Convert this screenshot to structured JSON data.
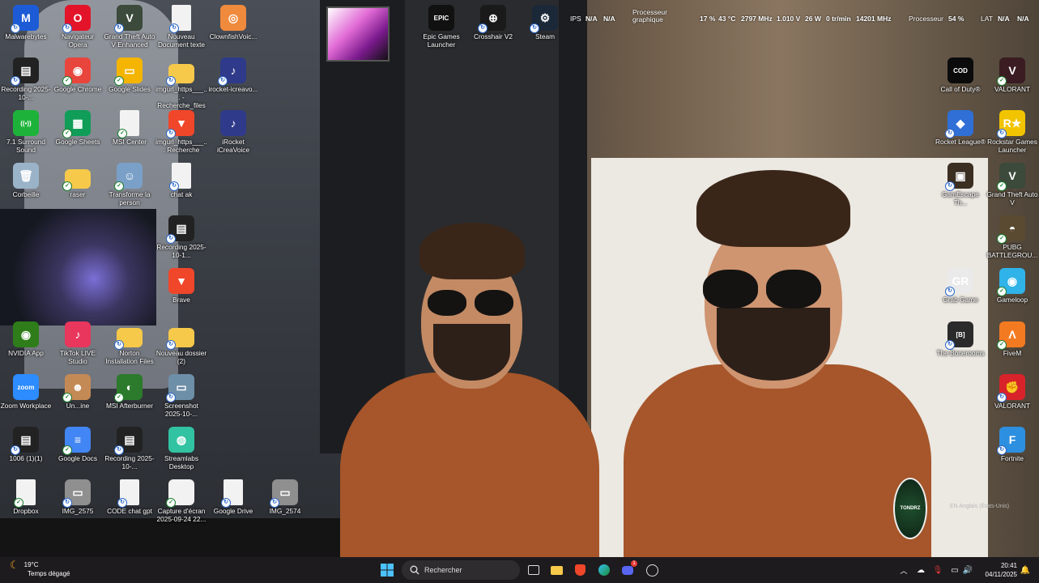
{
  "hud": {
    "ips_label": "IPS",
    "ips_val1": "N/A",
    "ips_val2": "N/A",
    "gpu_label_line1": "Processeur",
    "gpu_label_line2": "graphique",
    "gpu_usage": "17 %",
    "gpu_temp": "43 °C",
    "gpu_clock": "2797 MHz",
    "gpu_voltage": "1.010 V",
    "gpu_power": "26 W",
    "gpu_fan": "0 tr/min",
    "gpu_mem_clock": "14201 MHz",
    "cpu_label": "Processeur",
    "cpu_usage": "54 %",
    "lat_label": "LAT",
    "lat_val1": "N/A",
    "lat_val2": "N/A"
  },
  "desktop_icons": [
    {
      "label": "Malwarebytes",
      "icon": "malwarebytes-icon",
      "color": "#1d5bd6",
      "glyph": "M",
      "badge": "sync"
    },
    {
      "label": "Navigateur Opera",
      "icon": "opera-icon",
      "color": "#e3142a",
      "glyph": "O",
      "badge": "sync"
    },
    {
      "label": "Grand Theft Auto V Enhanced",
      "icon": "gta-icon",
      "color": "#3b4a3a",
      "glyph": "V",
      "badge": "sync"
    },
    {
      "label": "Nouveau Document texte",
      "icon": "text-file-icon",
      "color": "#f2f2f2",
      "glyph": "",
      "badge": "sync"
    },
    {
      "label": "ClownfishVoic...",
      "icon": "clownfish-icon",
      "color": "#f08a3c",
      "glyph": "◎",
      "badge": ""
    },
    {
      "label": "Recording 2025-10-...",
      "icon": "video-file-icon",
      "color": "#222",
      "glyph": "▤",
      "badge": "sync"
    },
    {
      "label": "Google Chrome",
      "icon": "chrome-icon",
      "color": "#e8453c",
      "glyph": "◉",
      "badge": "ok"
    },
    {
      "label": "Google Slides",
      "icon": "slides-icon",
      "color": "#f4b400",
      "glyph": "▭",
      "badge": "ok"
    },
    {
      "label": "imgurl_https___... - Recherche_files",
      "icon": "folder-icon",
      "color": "#f6c94a",
      "glyph": "",
      "badge": "sync"
    },
    {
      "label": "irocket-icreavo...",
      "icon": "irocket-icon",
      "color": "#2f3a8a",
      "glyph": "♪",
      "badge": "sync"
    },
    {
      "label": "7.1 Surround Sound",
      "icon": "surround-icon",
      "color": "#1db33a",
      "glyph": "((•))",
      "badge": ""
    },
    {
      "label": "Google Sheets",
      "icon": "sheets-icon",
      "color": "#0f9d58",
      "glyph": "▦",
      "badge": "ok"
    },
    {
      "label": "MSI Center",
      "icon": "text-file-icon",
      "color": "#f2f2f2",
      "glyph": "",
      "badge": "ok"
    },
    {
      "label": "imgurl_https___... Recherche",
      "icon": "brave-icon",
      "color": "#f0462a",
      "glyph": "▼",
      "badge": "sync"
    },
    {
      "label": "iRocket iCreaVoice",
      "icon": "irocket-icon",
      "color": "#2f3a8a",
      "glyph": "♪",
      "badge": ""
    },
    {
      "label": "Corbeille",
      "icon": "recycle-bin-icon",
      "color": "#9bb3c9",
      "glyph": "🗑",
      "badge": ""
    },
    {
      "label": "raser",
      "icon": "folder-icon",
      "color": "#f6c94a",
      "glyph": "",
      "badge": "ok"
    },
    {
      "label": "Transforme la person",
      "icon": "image-file-icon",
      "color": "#7aa0c8",
      "glyph": "☺",
      "badge": "ok"
    },
    {
      "label": "chat ak",
      "icon": "text-file-icon",
      "color": "#f2f2f2",
      "glyph": "",
      "badge": "sync"
    },
    {
      "label": "Recording 2025-10-1...",
      "icon": "video-file-icon",
      "color": "#222",
      "glyph": "▤",
      "badge": "sync"
    },
    {
      "label": "Brave",
      "icon": "brave-icon",
      "color": "#f0462a",
      "glyph": "▼",
      "badge": ""
    },
    {
      "label": "NVIDIA App",
      "icon": "nvidia-icon",
      "color": "#2e7d1a",
      "glyph": "◉",
      "badge": ""
    },
    {
      "label": "TikTok LIVE Studio",
      "icon": "tiktok-icon",
      "color": "#e8365d",
      "glyph": "♪",
      "badge": ""
    },
    {
      "label": "Norton Installation Files",
      "icon": "folder-icon",
      "color": "#f6c94a",
      "glyph": "",
      "badge": "sync"
    },
    {
      "label": "Nouveau dossier (2)",
      "icon": "folder-icon",
      "color": "#f6c94a",
      "glyph": "",
      "badge": "sync"
    },
    {
      "label": "Zoom Workplace",
      "icon": "zoom-icon",
      "color": "#2d8cff",
      "glyph": "zoom",
      "badge": ""
    },
    {
      "label": "Un...ine",
      "icon": "figure-icon",
      "color": "#c48a55",
      "glyph": "☻",
      "badge": "ok"
    },
    {
      "label": "MSI Afterburner",
      "icon": "afterburner-icon",
      "color": "#2c7a2c",
      "glyph": "◐",
      "badge": "ok"
    },
    {
      "label": "Screenshot 2025-10-...",
      "icon": "image-file-icon",
      "color": "#6e8fa8",
      "glyph": "▭",
      "badge": "sync"
    },
    {
      "label": "1006 (1)(1)",
      "icon": "video-file-icon",
      "color": "#222",
      "glyph": "▤",
      "badge": "sync"
    },
    {
      "label": "Google Docs",
      "icon": "docs-icon",
      "color": "#4285f4",
      "glyph": "≡",
      "badge": "ok"
    },
    {
      "label": "Recording 2025-10-...",
      "icon": "video-file-icon",
      "color": "#222",
      "glyph": "▤",
      "badge": "sync"
    },
    {
      "label": "Streamlabs Desktop",
      "icon": "streamlabs-icon",
      "color": "#31c3a2",
      "glyph": "◍",
      "badge": ""
    },
    {
      "label": "Dropbox",
      "icon": "text-file-icon",
      "color": "#f2f2f2",
      "glyph": "",
      "badge": "ok"
    },
    {
      "label": "IMG_2575",
      "icon": "image-file-icon",
      "color": "#8f8f8f",
      "glyph": "▭",
      "badge": "sync"
    },
    {
      "label": "CODE chat gpt",
      "icon": "text-file-icon",
      "color": "#f2f2f2",
      "glyph": "",
      "badge": "sync"
    },
    {
      "label": "Capture d'écran 2025-09-24 22...",
      "icon": "image-file-icon",
      "color": "#f2f2f2",
      "glyph": "",
      "badge": "ok"
    },
    {
      "label": "Google Drive",
      "icon": "text-file-icon",
      "color": "#f2f2f2",
      "glyph": "",
      "badge": "sync"
    },
    {
      "label": "IMG_2574",
      "icon": "image-file-icon",
      "color": "#8f8f8f",
      "glyph": "▭",
      "badge": "sync"
    },
    {
      "label": "Epic Games Launcher",
      "icon": "epic-icon",
      "color": "#111",
      "glyph": "EPIC",
      "badge": ""
    },
    {
      "label": "Crosshair V2",
      "icon": "crosshair-icon",
      "color": "#1a1a1a",
      "glyph": "⊕",
      "badge": "sync"
    },
    {
      "label": "Steam",
      "icon": "steam-icon",
      "color": "#1b2838",
      "glyph": "⚙",
      "badge": "sync"
    },
    {
      "label": "Call of Duty®",
      "icon": "cod-icon",
      "color": "#0b0b0b",
      "glyph": "COD",
      "badge": ""
    },
    {
      "label": "VALORANT",
      "icon": "valorant-icon",
      "color": "#3a1c22",
      "glyph": "V",
      "badge": "ok"
    },
    {
      "label": "Rocket League®",
      "icon": "rocket-league-icon",
      "color": "#2f6fd6",
      "glyph": "◆",
      "badge": "sync"
    },
    {
      "label": "Rockstar Games Launcher",
      "icon": "rockstar-icon",
      "color": "#f2c400",
      "glyph": "R★",
      "badge": "sync"
    },
    {
      "label": "GamEscape Th...",
      "icon": "game-icon",
      "color": "#3b2f22",
      "glyph": "▣",
      "badge": "sync"
    },
    {
      "label": "Grand Theft Auto V",
      "icon": "gta-icon",
      "color": "#3b4a3a",
      "glyph": "V",
      "badge": "ok"
    },
    {
      "label": "PUBG BATTLEGROU...",
      "icon": "pubg-icon",
      "color": "#5a4a32",
      "glyph": "◓",
      "badge": "ok"
    },
    {
      "label": "Grab Game",
      "icon": "grab-game-icon",
      "color": "#eaeaea",
      "glyph": "GR",
      "badge": "sync"
    },
    {
      "label": "Gameloop",
      "icon": "gameloop-icon",
      "color": "#2fb3e8",
      "glyph": "◉",
      "badge": "ok"
    },
    {
      "label": "The Bonerooms",
      "icon": "bonerooms-icon",
      "color": "#2b2b2b",
      "glyph": "[B]",
      "badge": "sync"
    },
    {
      "label": "FiveM",
      "icon": "fivem-icon",
      "color": "#f47a21",
      "glyph": "Λ",
      "badge": "ok"
    },
    {
      "label": "VALORANT",
      "icon": "valorant-icon",
      "color": "#d8232a",
      "glyph": "✊",
      "badge": "sync"
    },
    {
      "label": "Fortnite",
      "icon": "fortnite-icon",
      "color": "#2d8fe0",
      "glyph": "F",
      "badge": "sync"
    }
  ],
  "watermark": "EN Anglais (États-Unis)",
  "emblem": "TONDRZ",
  "taskbar": {
    "weather_temp": "19°C",
    "weather_desc": "Temps dégagé",
    "search_placeholder": "Rechercher",
    "time": "20:41",
    "date": "04/11/2025",
    "discord_badge": "1"
  },
  "colors": {
    "taskbar_bg": "#1d1b1e",
    "accent": "#0a84ff"
  }
}
